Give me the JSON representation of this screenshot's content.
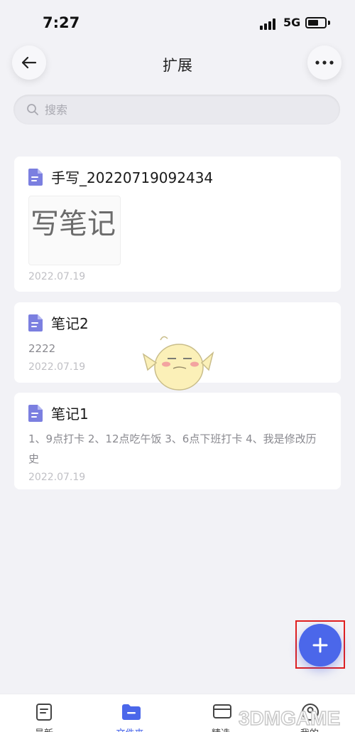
{
  "status_bar": {
    "time": "7:27",
    "network": "5G",
    "battery_level": 0.65
  },
  "header": {
    "title": "扩展",
    "back_icon": "arrow-left-icon",
    "more_icon": "more-dots-icon"
  },
  "search": {
    "placeholder": "搜索",
    "value": ""
  },
  "notes": [
    {
      "title": "手写_20220719092434",
      "thumbnail_text": "写笔记",
      "date": "2022.07.19",
      "icon": "document-icon"
    },
    {
      "title": "笔记2",
      "content": "2222",
      "date": "2022.07.19",
      "icon": "document-icon"
    },
    {
      "title": "笔记1",
      "content": "1、9点打卡 2、12点吃午饭 3、6点下班打卡 4、我是修改历史",
      "date": "2022.07.19",
      "icon": "document-icon"
    }
  ],
  "fab": {
    "icon": "plus-icon"
  },
  "tabbar": {
    "items": [
      {
        "label": "最新",
        "icon": "note-icon"
      },
      {
        "label": "文件夹",
        "icon": "folder-icon",
        "active": true
      },
      {
        "label": "精选",
        "icon": "card-icon"
      },
      {
        "label": "我的",
        "icon": "profile-icon"
      }
    ]
  },
  "watermark": "3DMGAME",
  "colors": {
    "accent": "#4b67ea",
    "background": "#f2f2f6",
    "doc_icon": "#7b7fe0",
    "highlight_box": "#e02020"
  }
}
